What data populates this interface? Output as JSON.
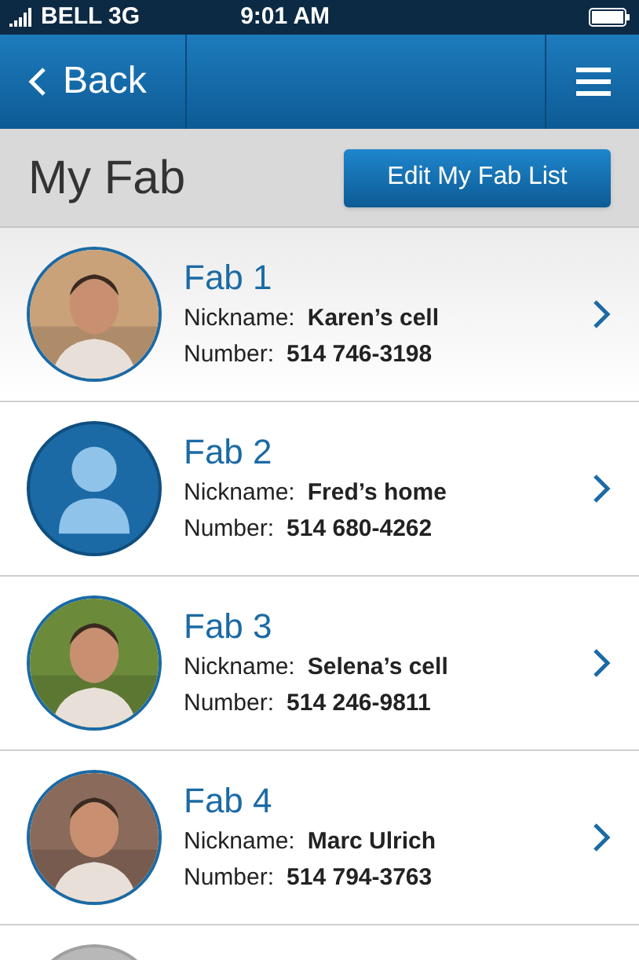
{
  "status_bar": {
    "carrier": "BELL 3G",
    "time": "9:01 AM"
  },
  "nav": {
    "back": "Back"
  },
  "header": {
    "title": "My Fab",
    "edit_button": "Edit My Fab List"
  },
  "fabs": [
    {
      "title": "Fab 1",
      "nickname_label": "Nickname:",
      "nickname": "Karen’s cell",
      "number_label": "Number:",
      "number": "514 746-3198",
      "selected": true
    },
    {
      "title": "Fab 2",
      "nickname_label": "Nickname:",
      "nickname": "Fred’s home",
      "number_label": "Number:",
      "number": "514 680-4262",
      "avatar": {
        "kind": "placeholder"
      },
      "selected": false
    },
    {
      "title": "Fab 3",
      "nickname_label": "Nickname:",
      "nickname": "Selena’s cell",
      "number_label": "Number:",
      "number": "514 246-9811",
      "selected": false
    },
    {
      "title": "Fab 4",
      "nickname_label": "Nickname:",
      "nickname": "Marc Ulrich",
      "number_label": "Number:",
      "number": "514 794-3763",
      "selected": false
    },
    {
      "avatar": {
        "kind": "empty"
      },
      "selected": false
    }
  ]
}
